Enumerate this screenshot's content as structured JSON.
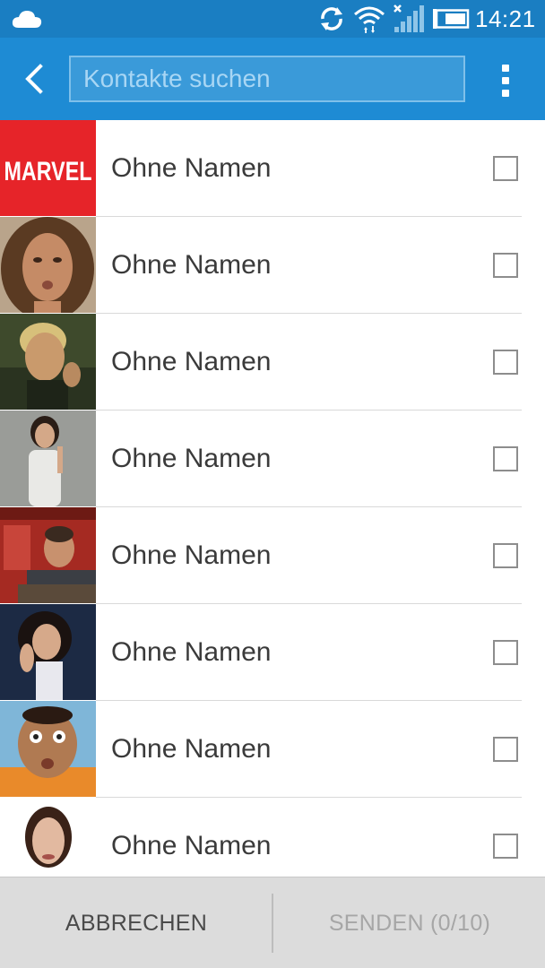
{
  "status_bar": {
    "time": "14:21",
    "icons": [
      "cloud-icon",
      "sync-icon",
      "wifi-icon",
      "signal-icon",
      "battery-icon"
    ]
  },
  "app_bar": {
    "back_icon": "chevron-left-icon",
    "search_placeholder": "Kontakte suchen",
    "search_value": "",
    "menu_icon": "overflow-menu-icon"
  },
  "contacts": [
    {
      "name": "Ohne Namen",
      "avatar": "marvel-logo",
      "checked": false
    },
    {
      "name": "Ohne Namen",
      "avatar": "photo-woman-curly-hair",
      "checked": false
    },
    {
      "name": "Ohne Namen",
      "avatar": "photo-man-blond",
      "checked": false
    },
    {
      "name": "Ohne Namen",
      "avatar": "photo-woman-pointing",
      "checked": false
    },
    {
      "name": "Ohne Namen",
      "avatar": "photo-man-desk",
      "checked": false
    },
    {
      "name": "Ohne Namen",
      "avatar": "photo-woman-dark-hair",
      "checked": false
    },
    {
      "name": "Ohne Namen",
      "avatar": "photo-man-funny-face",
      "checked": false
    },
    {
      "name": "Ohne Namen",
      "avatar": "photo-woman-smiling",
      "checked": false
    }
  ],
  "avatar_labels": {
    "marvel": "MARVEL"
  },
  "bottom_bar": {
    "cancel_label": "ABBRECHEN",
    "send_label": "SENDEN (0/10)"
  },
  "colors": {
    "status_bar": "#1a7ec2",
    "app_bar": "#1e8bd4",
    "marvel_red": "#e62429"
  }
}
